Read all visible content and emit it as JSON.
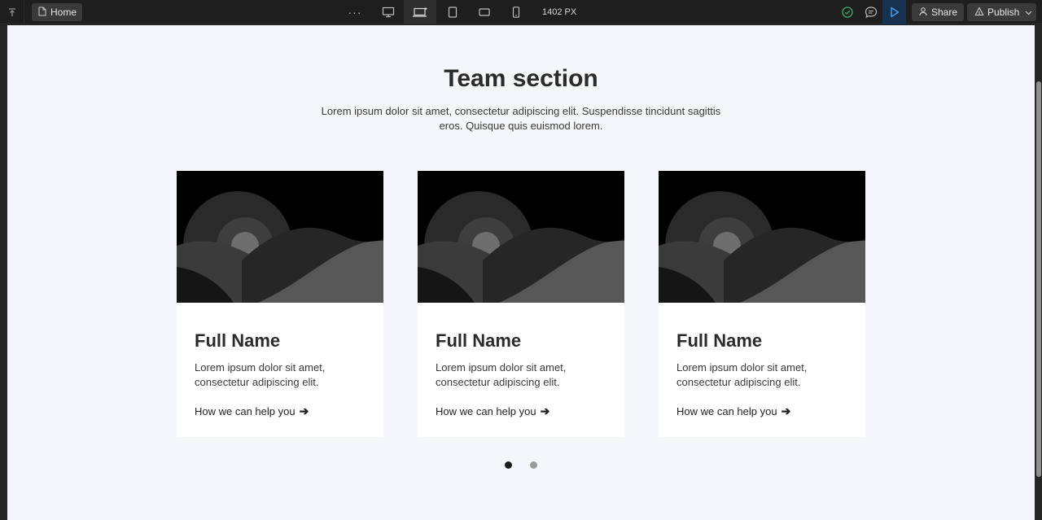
{
  "toolbar": {
    "page_name": "Home",
    "more_label": "···",
    "viewport_width": "1402 PX",
    "share_label": "Share",
    "publish_label": "Publish"
  },
  "section": {
    "title": "Team section",
    "subtitle": "Lorem ipsum dolor sit amet, consectetur adipiscing elit. Suspendisse tincidunt sagittis eros. Quisque quis euismod lorem."
  },
  "cards": [
    {
      "name": "Full Name",
      "description": "Lorem ipsum dolor sit amet, consectetur adipiscing elit.",
      "link": "How we can help you"
    },
    {
      "name": "Full Name",
      "description": "Lorem ipsum dolor sit amet, consectetur adipiscing elit.",
      "link": "How we can help you"
    },
    {
      "name": "Full Name",
      "description": "Lorem ipsum dolor sit amet, consectetur adipiscing elit.",
      "link": "How we can help you"
    }
  ],
  "carousel": {
    "page_count": 2,
    "active_index": 0
  },
  "icons": {
    "collapse": "collapse-up-icon",
    "page": "page-icon",
    "desktop": "desktop-icon",
    "laptop": "laptop-icon",
    "tablet": "tablet-icon",
    "tablet_landscape": "tablet-landscape-icon",
    "mobile": "mobile-icon",
    "status": "check-circle-icon",
    "comments": "comment-icon",
    "preview": "play-icon",
    "share": "user-icon",
    "publish": "publish-icon",
    "dropdown": "chevron-down-icon",
    "arrow": "arrow-right-icon"
  },
  "colors": {
    "accent_preview": "#17324f",
    "status_green": "#3fae6a",
    "canvas_bg": "#f5f6f9",
    "card_bg": "#ffffff"
  }
}
